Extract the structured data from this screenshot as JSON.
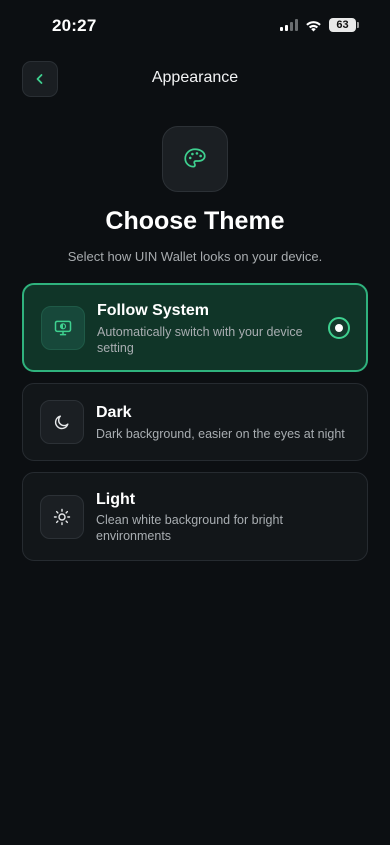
{
  "status_bar": {
    "time": "20:27",
    "battery": "63"
  },
  "header": {
    "title": "Appearance",
    "back_icon": "chevron-left-icon"
  },
  "hero": {
    "icon": "palette-icon",
    "title": "Choose Theme",
    "subtitle": "Select how UIN Wallet looks on your device."
  },
  "options": [
    {
      "id": "system",
      "icon": "monitor-icon",
      "title": "Follow System",
      "description": "Automatically switch with your device setting",
      "selected": true
    },
    {
      "id": "dark",
      "icon": "moon-icon",
      "title": "Dark",
      "description": "Dark background, easier on the eyes at night",
      "selected": false
    },
    {
      "id": "light",
      "icon": "sun-icon",
      "title": "Light",
      "description": "Clean white background for bright environments",
      "selected": false
    }
  ],
  "colors": {
    "accent": "#3ed08f",
    "background": "#0c0f12",
    "selected_card": "#103528"
  }
}
